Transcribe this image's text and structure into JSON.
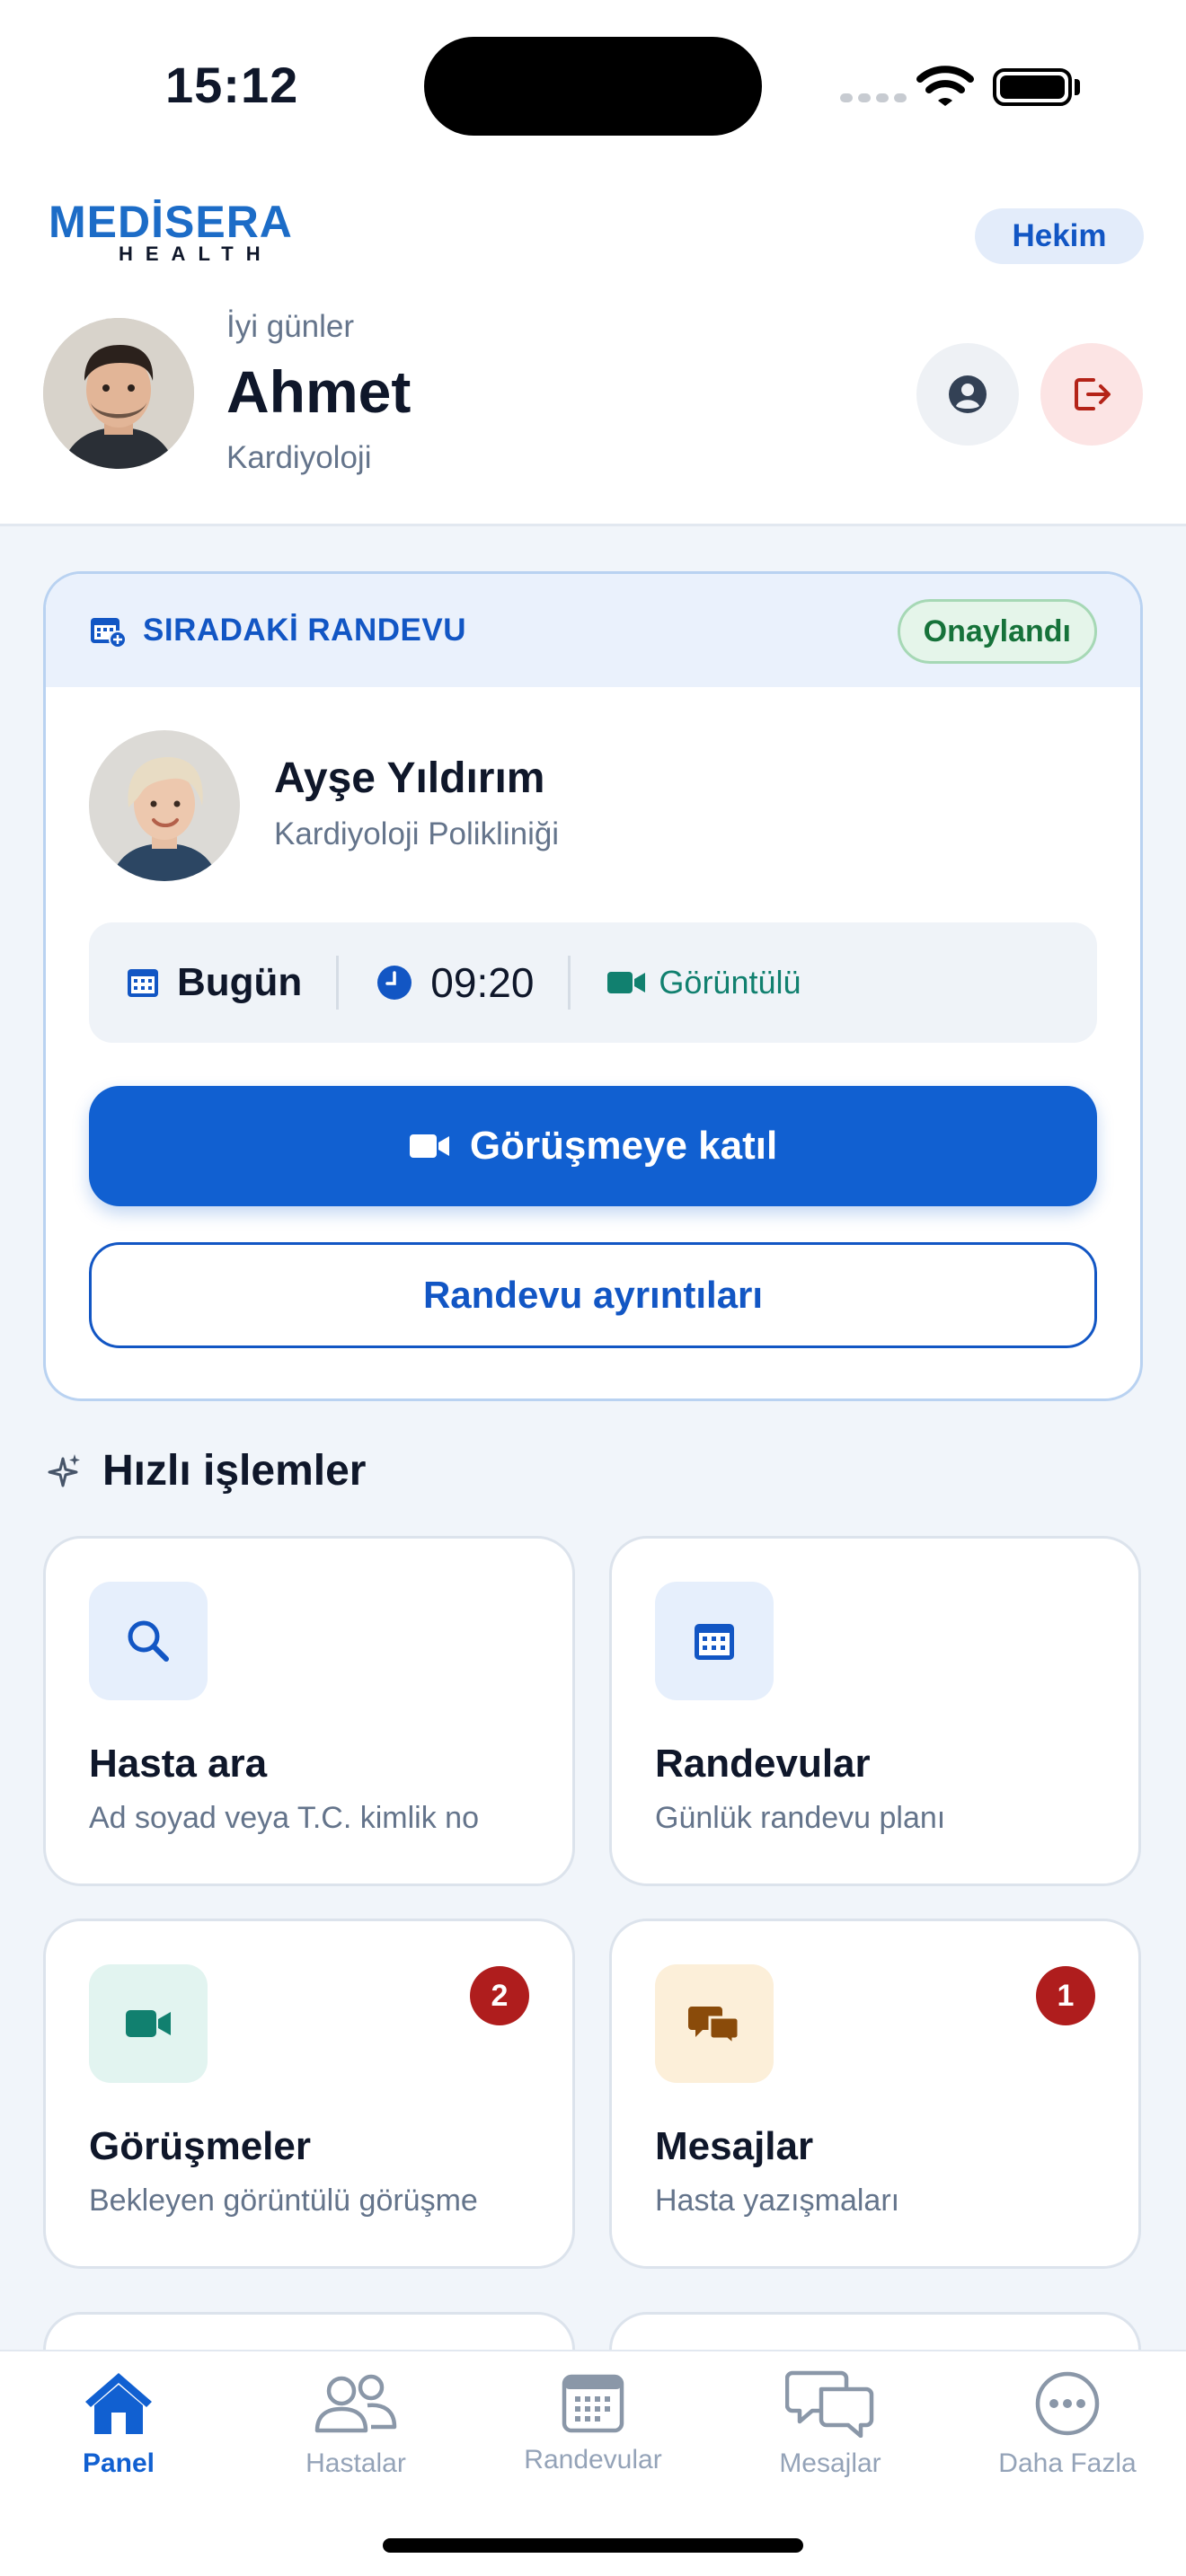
{
  "status_bar": {
    "time": "15:12"
  },
  "header": {
    "brand_top": "MEDİSERA",
    "brand_bottom": "HEALTH",
    "role_badge": "Hekim",
    "greeting": "İyi günler",
    "user_name": "Ahmet",
    "department": "Kardiyoloji"
  },
  "next_appointment": {
    "section_label": "SIRADAKİ RANDEVU",
    "status": "Onaylandı",
    "patient_name": "Ayşe Yıldırım",
    "clinic": "Kardiyoloji Polikliniği",
    "date": "Bugün",
    "time": "09:20",
    "type": "Görüntülü",
    "join_label": "Görüşmeye katıl",
    "details_label": "Randevu ayrıntıları"
  },
  "quick_actions": {
    "title": "Hızlı işlemler",
    "items": [
      {
        "title": "Hasta ara",
        "subtitle": "Ad soyad veya T.C. kimlik no",
        "icon": "search-icon"
      },
      {
        "title": "Randevular",
        "subtitle": "Günlük randevu planı",
        "icon": "calendar-icon"
      },
      {
        "title": "Görüşmeler",
        "subtitle": "Bekleyen görüntülü görüşme",
        "icon": "video-icon",
        "badge": "2"
      },
      {
        "title": "Mesajlar",
        "subtitle": "Hasta yazışmaları",
        "icon": "chat-icon",
        "badge": "1"
      }
    ]
  },
  "tabbar": {
    "items": [
      {
        "label": "Panel",
        "icon": "home-icon",
        "active": true
      },
      {
        "label": "Hastalar",
        "icon": "users-icon"
      },
      {
        "label": "Randevular",
        "icon": "calendar-icon"
      },
      {
        "label": "Mesajlar",
        "icon": "chat-icon"
      },
      {
        "label": "Daha Fazla",
        "icon": "more-icon"
      }
    ]
  },
  "colors": {
    "primary": "#1160D1",
    "success": "#16723A",
    "danger": "#AF1D1D",
    "teal": "#11806F",
    "amber": "#8A4B0A"
  }
}
